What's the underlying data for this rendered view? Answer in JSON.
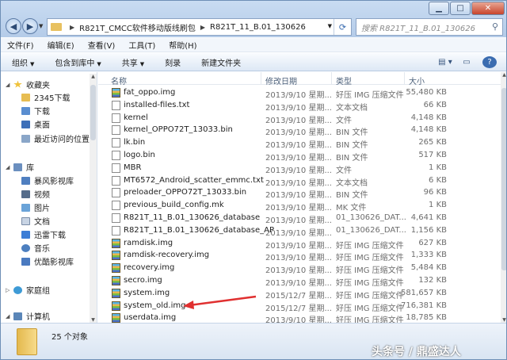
{
  "address": {
    "segments": [
      "R821T_CMCC软件移动版线刷包",
      "R821T_11_B.01_130626"
    ]
  },
  "search": {
    "placeholder": "搜索 R821T_11_B.01_130626"
  },
  "menu": [
    "文件(F)",
    "编辑(E)",
    "查看(V)",
    "工具(T)",
    "帮助(H)"
  ],
  "toolbar": {
    "organize": "组织",
    "include": "包含到库中",
    "share": "共享",
    "burn": "刻录",
    "newfolder": "新建文件夹"
  },
  "sidebar": {
    "items": [
      {
        "label": "收藏夹",
        "icon": "star-icon"
      },
      {
        "label": "2345下载",
        "icon": "folder-icon"
      },
      {
        "label": "下载",
        "icon": "download-folder-icon"
      },
      {
        "label": "桌面",
        "icon": "desktop-icon"
      },
      {
        "label": "最近访问的位置",
        "icon": "recent-places-icon"
      },
      {
        "label": "库",
        "icon": "library-icon"
      },
      {
        "label": "暴风影视库",
        "icon": "video-library-icon"
      },
      {
        "label": "视频",
        "icon": "video-icon"
      },
      {
        "label": "图片",
        "icon": "picture-icon"
      },
      {
        "label": "文档",
        "icon": "document-icon"
      },
      {
        "label": "迅雷下载",
        "icon": "thunder-download-icon"
      },
      {
        "label": "音乐",
        "icon": "music-icon"
      },
      {
        "label": "优酷影视库",
        "icon": "youku-library-icon"
      },
      {
        "label": "家庭组",
        "icon": "homegroup-icon"
      },
      {
        "label": "计算机",
        "icon": "computer-icon"
      }
    ]
  },
  "columns": {
    "name": "名称",
    "date": "修改日期",
    "type": "类型",
    "size": "大小"
  },
  "files": [
    {
      "name": "fat_oppo.img",
      "date": "2013/9/10 星期...",
      "type": "好压 IMG 压缩文件",
      "size": "55,480 KB",
      "icon": "img"
    },
    {
      "name": "installed-files.txt",
      "date": "2013/9/10 星期...",
      "type": "文本文档",
      "size": "66 KB",
      "icon": "txt"
    },
    {
      "name": "kernel",
      "date": "2013/9/10 星期...",
      "type": "文件",
      "size": "4,148 KB",
      "icon": "txt"
    },
    {
      "name": "kernel_OPPO72T_13033.bin",
      "date": "2013/9/10 星期...",
      "type": "BIN 文件",
      "size": "4,148 KB",
      "icon": "txt"
    },
    {
      "name": "lk.bin",
      "date": "2013/9/10 星期...",
      "type": "BIN 文件",
      "size": "265 KB",
      "icon": "txt"
    },
    {
      "name": "logo.bin",
      "date": "2013/9/10 星期...",
      "type": "BIN 文件",
      "size": "517 KB",
      "icon": "txt"
    },
    {
      "name": "MBR",
      "date": "2013/9/10 星期...",
      "type": "文件",
      "size": "1 KB",
      "icon": "txt"
    },
    {
      "name": "MT6572_Android_scatter_emmc.txt",
      "date": "2013/9/10 星期...",
      "type": "文本文档",
      "size": "6 KB",
      "icon": "txt"
    },
    {
      "name": "preloader_OPPO72T_13033.bin",
      "date": "2013/9/10 星期...",
      "type": "BIN 文件",
      "size": "96 KB",
      "icon": "txt"
    },
    {
      "name": "previous_build_config.mk",
      "date": "2013/9/10 星期...",
      "type": "MK 文件",
      "size": "1 KB",
      "icon": "txt"
    },
    {
      "name": "R821T_11_B.01_130626_database",
      "date": "2013/9/10 星期...",
      "type": "01_130626_DAT...",
      "size": "4,641 KB",
      "icon": "txt"
    },
    {
      "name": "R821T_11_B.01_130626_database_AP",
      "date": "2013/9/10 星期...",
      "type": "01_130626_DAT...",
      "size": "1,156 KB",
      "icon": "txt"
    },
    {
      "name": "ramdisk.img",
      "date": "2013/9/10 星期...",
      "type": "好压 IMG 压缩文件",
      "size": "627 KB",
      "icon": "img"
    },
    {
      "name": "ramdisk-recovery.img",
      "date": "2013/9/10 星期...",
      "type": "好压 IMG 压缩文件",
      "size": "1,333 KB",
      "icon": "img"
    },
    {
      "name": "recovery.img",
      "date": "2013/9/10 星期...",
      "type": "好压 IMG 压缩文件",
      "size": "5,484 KB",
      "icon": "img"
    },
    {
      "name": "secro.img",
      "date": "2013/9/10 星期...",
      "type": "好压 IMG 压缩文件",
      "size": "132 KB",
      "icon": "img"
    },
    {
      "name": "system.img",
      "date": "2015/12/7 星期...",
      "type": "好压 IMG 压缩文件",
      "size": "581,657 KB",
      "icon": "img"
    },
    {
      "name": "system_old.img",
      "date": "2015/12/7 星期...",
      "type": "好压 IMG 压缩文件",
      "size": "716,381 KB",
      "icon": "img"
    },
    {
      "name": "userdata.img",
      "date": "2013/9/10 星期...",
      "type": "好压 IMG 压缩文件",
      "size": "18,785 KB",
      "icon": "img"
    }
  ],
  "status": {
    "count": "25 个对象"
  },
  "watermark": "头条号 / 鼎盛达人",
  "colors": {
    "accent": "#3b6cb0",
    "arrow": "#e03030",
    "titlebar": "#b4cbe8"
  }
}
